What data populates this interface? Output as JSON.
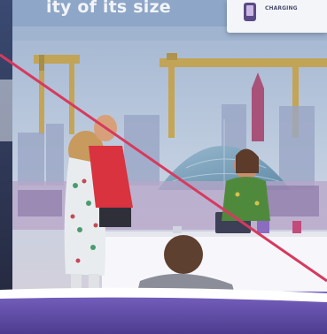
{
  "banner": {
    "headline": "ity of its size",
    "card_text": "CHARGING"
  },
  "scene": {
    "description_colors": {
      "sky": "#b9c9dd",
      "counter": "#ffffff",
      "accent_line": "#d63a5e",
      "booth_base": "#6c5ab4"
    }
  }
}
